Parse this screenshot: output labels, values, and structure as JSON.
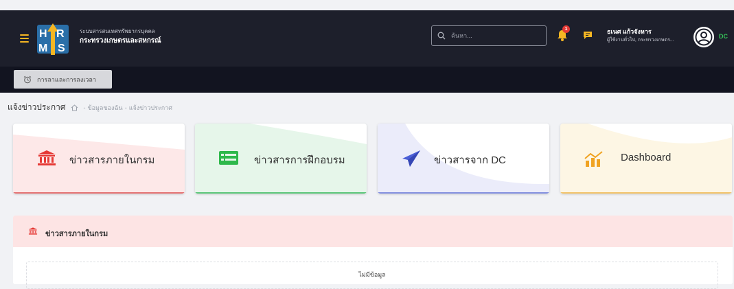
{
  "header": {
    "brand_line1": "ระบบสารสนเทศทรัพยากรบุคคล",
    "brand_line2": "กระทรวงเกษตรและสหกรณ์",
    "search_placeholder": "ค้นหา...",
    "notification_count": "1",
    "user_name": "ธเนศ แก้วจังหาร",
    "user_role": "ผู้ใช้งานทั่วไป, กระทรวงเกษตร...",
    "user_code": "DC"
  },
  "subnav": {
    "leave_button": "การลาและการลงเวลา"
  },
  "breadcrumb": {
    "title": "แจ้งข่าวประกาศ",
    "items": [
      "ข้อมูลของฉัน",
      "แจ้งข่าวประกาศ"
    ],
    "separator": "-"
  },
  "cards": [
    {
      "label": "ข่าวสารภายในกรม",
      "icon": "bank-icon",
      "color": "#e53935"
    },
    {
      "label": "ข่าวสารการฝึกอบรม",
      "icon": "training-list-icon",
      "color": "#2eb84b"
    },
    {
      "label": "ข่าวสารจาก DC",
      "icon": "paper-plane-icon",
      "color": "#4b5fd6"
    },
    {
      "label": "Dashboard",
      "icon": "chart-icon",
      "color": "#f0a322"
    }
  ],
  "panel": {
    "title": "ข่าวสารภายในกรม",
    "empty_text": "ไม่มีข้อมูล"
  },
  "colors": {
    "topbar": "#1d1f2b",
    "accent": "#f5b623",
    "panel_header": "#fde4e4"
  }
}
